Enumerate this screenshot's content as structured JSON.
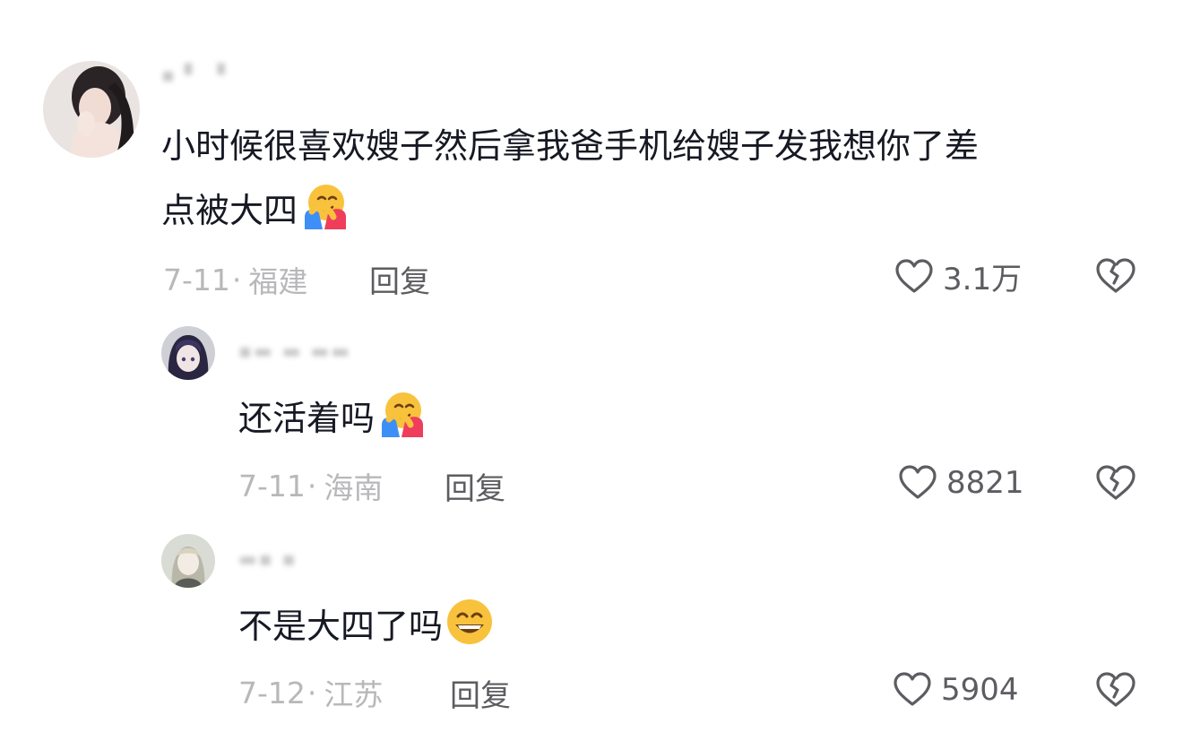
{
  "comments": [
    {
      "text_line1": "小时候很喜欢嫂子然后拿我爸手机给嫂子发我想你了差",
      "text_line2": "点被大四",
      "emoji": "hugging-face-icon",
      "date": "7-11",
      "location": "福建",
      "reply_label": "回复",
      "likes": "3.1万"
    },
    {
      "text": "还活着吗",
      "emoji": "hugging-face-icon",
      "date": "7-11",
      "location": "海南",
      "reply_label": "回复",
      "likes": "8821"
    },
    {
      "text": "不是大四了吗",
      "emoji": "grinning-face-icon",
      "date": "7-12",
      "location": "江苏",
      "reply_label": "回复",
      "likes": "5904"
    }
  ],
  "colors": {
    "text": "#161823",
    "meta": "#b8b8bb",
    "action": "#5c5c61"
  }
}
